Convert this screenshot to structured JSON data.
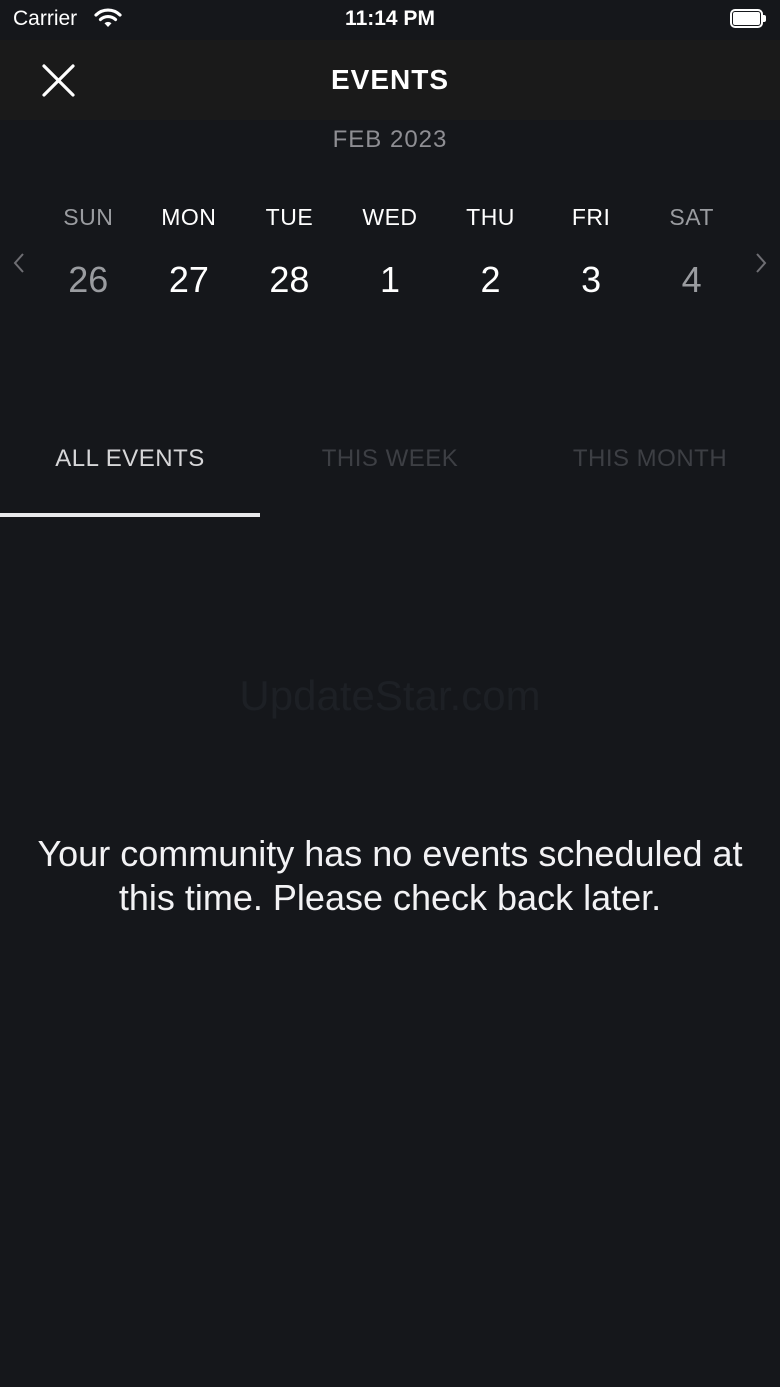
{
  "status_bar": {
    "carrier": "Carrier",
    "time": "11:14 PM"
  },
  "header": {
    "title": "EVENTS",
    "close_icon": "close-icon"
  },
  "calendar": {
    "month": "FEB 2023",
    "days": [
      {
        "name": "SUN",
        "date": "26",
        "muted": true
      },
      {
        "name": "MON",
        "date": "27",
        "muted": false
      },
      {
        "name": "TUE",
        "date": "28",
        "muted": false
      },
      {
        "name": "WED",
        "date": "1",
        "muted": false
      },
      {
        "name": "THU",
        "date": "2",
        "muted": false
      },
      {
        "name": "FRI",
        "date": "3",
        "muted": false
      },
      {
        "name": "SAT",
        "date": "4",
        "muted": true
      }
    ]
  },
  "tabs": [
    {
      "label": "ALL EVENTS",
      "selected": true
    },
    {
      "label": "THIS WEEK",
      "selected": false
    },
    {
      "label": "THIS MONTH",
      "selected": false
    }
  ],
  "watermark": "UpdateStar.com",
  "empty_message": "Your community has no events scheduled at this time. Please check back later.",
  "colors": {
    "background": "#15171b",
    "nav_background": "#1a1a1a",
    "muted_text": "#8e8e93",
    "inactive_tab": "#3d3f44"
  }
}
